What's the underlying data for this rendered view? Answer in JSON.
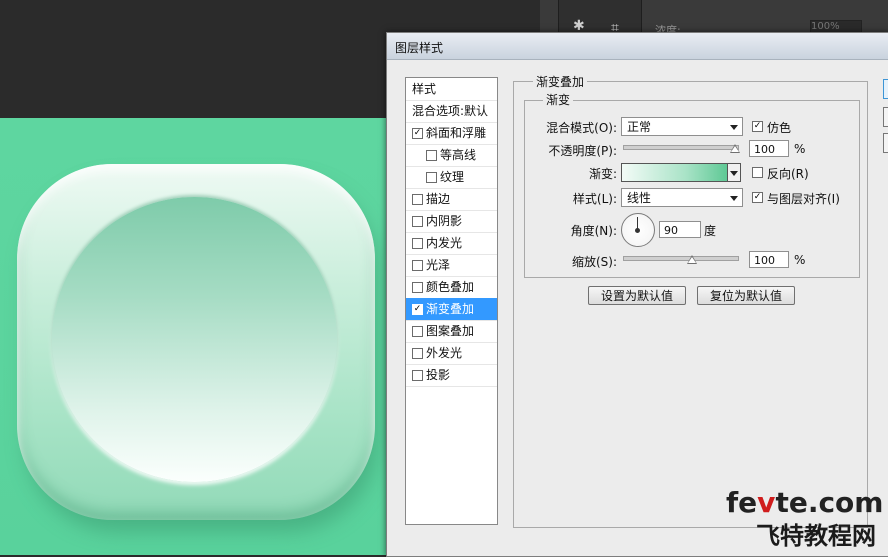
{
  "background_colors": {
    "canvas": "#5ed6a0",
    "dark": "#2b2b2b",
    "selection": "#3399ff"
  },
  "ps_panel": {
    "opacity_label": "浓度:",
    "opacity_value": "100%"
  },
  "dialog": {
    "title": "图层样式",
    "style_list": [
      {
        "label": "样式",
        "checkbox": false,
        "checked": false,
        "indent": false,
        "selected": false
      },
      {
        "label": "混合选项:默认",
        "checkbox": false,
        "checked": false,
        "indent": false,
        "selected": false
      },
      {
        "label": "斜面和浮雕",
        "checkbox": true,
        "checked": true,
        "indent": false,
        "selected": false
      },
      {
        "label": "等高线",
        "checkbox": true,
        "checked": false,
        "indent": true,
        "selected": false
      },
      {
        "label": "纹理",
        "checkbox": true,
        "checked": false,
        "indent": true,
        "selected": false
      },
      {
        "label": "描边",
        "checkbox": true,
        "checked": false,
        "indent": false,
        "selected": false
      },
      {
        "label": "内阴影",
        "checkbox": true,
        "checked": false,
        "indent": false,
        "selected": false
      },
      {
        "label": "内发光",
        "checkbox": true,
        "checked": false,
        "indent": false,
        "selected": false
      },
      {
        "label": "光泽",
        "checkbox": true,
        "checked": false,
        "indent": false,
        "selected": false
      },
      {
        "label": "颜色叠加",
        "checkbox": true,
        "checked": false,
        "indent": false,
        "selected": false
      },
      {
        "label": "渐变叠加",
        "checkbox": true,
        "checked": true,
        "indent": false,
        "selected": true
      },
      {
        "label": "图案叠加",
        "checkbox": true,
        "checked": false,
        "indent": false,
        "selected": false
      },
      {
        "label": "外发光",
        "checkbox": true,
        "checked": false,
        "indent": false,
        "selected": false
      },
      {
        "label": "投影",
        "checkbox": true,
        "checked": false,
        "indent": false,
        "selected": false
      }
    ],
    "section_title": "渐变叠加",
    "group_title": "渐变",
    "blend_mode": {
      "label": "混合模式(O):",
      "value": "正常"
    },
    "dither": {
      "label": "仿色",
      "checked": true
    },
    "opacity": {
      "label": "不透明度(P):",
      "value": "100",
      "unit": "%",
      "level": 1.0
    },
    "gradient": {
      "label": "渐变:"
    },
    "reverse": {
      "label": "反向(R)",
      "checked": false
    },
    "style": {
      "label": "样式(L):",
      "value": "线性"
    },
    "align": {
      "label": "与图层对齐(I)",
      "checked": true
    },
    "angle": {
      "label": "角度(N):",
      "value": "90",
      "unit": "度"
    },
    "scale": {
      "label": "缩放(S):",
      "value": "100",
      "unit": "%",
      "level": 0.5
    },
    "buttons": {
      "make_default": "设置为默认值",
      "reset_default": "复位为默认值"
    }
  },
  "watermark": {
    "line1_prefix": "fe",
    "line1_accent": "v",
    "line1_suffix": "te.com",
    "line2": "飞特教程网"
  }
}
